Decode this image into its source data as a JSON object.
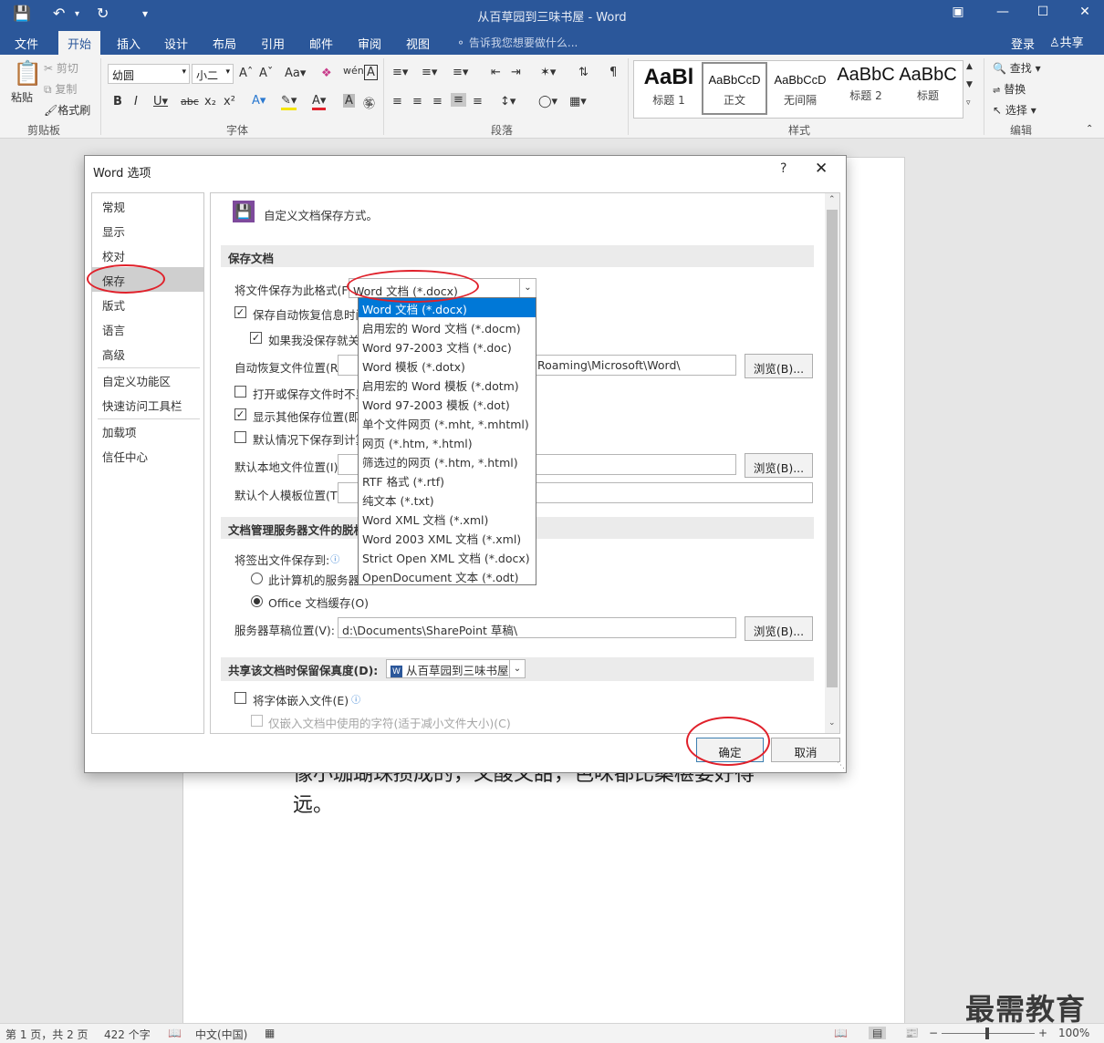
{
  "window": {
    "title": "从百草园到三味书屋 - Word",
    "tell_me": "告诉我您想要做什么...",
    "login": "登录",
    "share": "共享",
    "tabs": [
      "文件",
      "开始",
      "插入",
      "设计",
      "布局",
      "引用",
      "邮件",
      "审阅",
      "视图"
    ]
  },
  "ribbon": {
    "clipboard": {
      "paste": "粘贴",
      "cut": "剪切",
      "copy": "复制",
      "format_painter": "格式刷",
      "label": "剪贴板"
    },
    "font": {
      "name": "幼圆",
      "size": "小二",
      "label": "字体"
    },
    "paragraph": {
      "label": "段落"
    },
    "styles": {
      "label": "样式",
      "items": [
        {
          "sample": "AaBl",
          "name": "标题 1"
        },
        {
          "sample": "AaBbCcD",
          "name": "正文"
        },
        {
          "sample": "AaBbCcD",
          "name": "无间隔"
        },
        {
          "sample": "AaBbC",
          "name": "标题 2"
        },
        {
          "sample": "AaBbC",
          "name": "标题"
        }
      ]
    },
    "editing": {
      "find": "查找",
      "replace": "替换",
      "select": "选择",
      "label": "编辑"
    }
  },
  "document": {
    "text_line1": "像小珈瑚珠攒成的，又酸又甜，色味都比桑椹要好得",
    "text_line2": "远。"
  },
  "status": {
    "page": "第 1 页，共 2 页",
    "words": "422 个字",
    "language": "中文(中国)",
    "zoom": "100%",
    "watermark": "最需教育"
  },
  "dialog": {
    "title": "Word 选项",
    "help": "?",
    "close": "✕",
    "nav": [
      "常规",
      "显示",
      "校对",
      "保存",
      "版式",
      "语言",
      "高级",
      "自定义功能区",
      "快速访问工具栏",
      "加载项",
      "信任中心"
    ],
    "nav_selected": "保存",
    "heading": "自定义文档保存方式。",
    "save_section": "保存文档",
    "save_format_label": "将文件保存为此格式(F):",
    "save_format_value": "Word 文档 (*.docx)",
    "autorecover_label": "保存自动恢复信息时间",
    "keep_last_label": "如果我没保存就关",
    "autorecover_location_label": "自动恢复文件位置(R):",
    "autorecover_location_value": "Roaming\\Microsoft\\Word\\",
    "browse": "浏览(B)...",
    "dont_show_backstage": "打开或保存文件时不显",
    "show_other_locations": "显示其他保存位置(即使",
    "save_to_computer": "默认情况下保存到计算",
    "default_local_label": "默认本地文件位置(I):",
    "default_template_label": "默认个人模板位置(T):",
    "server_section": "文档管理服务器文件的脱机",
    "checkout_label": "将签出文件保存到:",
    "radio_server": "此计算机的服务器",
    "radio_office": "Office 文档缓存(O)",
    "server_drafts_label": "服务器草稿位置(V):",
    "server_drafts_value": "d:\\Documents\\SharePoint 草稿\\",
    "fidelity_label": "共享该文档时保留保真度(D):",
    "fidelity_doc": "从百草园到三味书屋",
    "embed_fonts": "将字体嵌入文件(E)",
    "embed_used_only": "仅嵌入文档中使用的字符(适于减小文件大小)(C)",
    "ok": "确定",
    "cancel": "取消",
    "format_options": [
      "Word 文档 (*.docx)",
      "启用宏的 Word 文档 (*.docm)",
      "Word 97-2003 文档 (*.doc)",
      "Word 模板 (*.dotx)",
      "启用宏的 Word 模板 (*.dotm)",
      "Word 97-2003 模板 (*.dot)",
      "单个文件网页 (*.mht, *.mhtml)",
      "网页 (*.htm, *.html)",
      "筛选过的网页 (*.htm, *.html)",
      "RTF 格式 (*.rtf)",
      "纯文本 (*.txt)",
      "Word XML 文档 (*.xml)",
      "Word 2003 XML 文档 (*.xml)",
      "Strict Open XML 文档 (*.docx)",
      "OpenDocument 文本 (*.odt)"
    ]
  },
  "colors": {
    "word_blue": "#2b579a",
    "highlight": "#0078d7",
    "annotation_red": "#e0212b"
  }
}
